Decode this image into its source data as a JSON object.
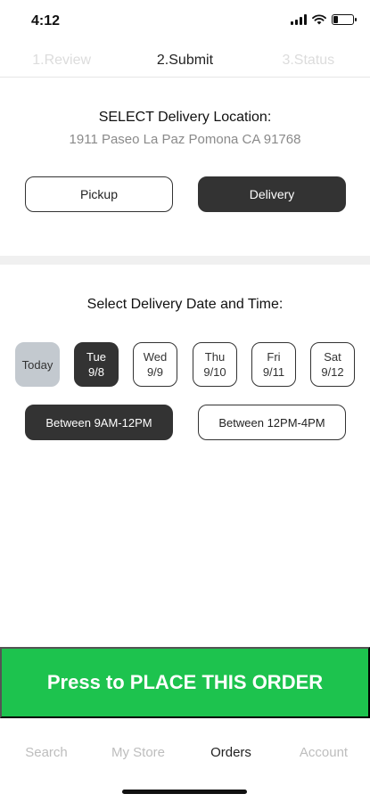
{
  "status_bar": {
    "time": "4:12"
  },
  "steps": [
    {
      "label": "1.Review"
    },
    {
      "label": "2.Submit"
    },
    {
      "label": "3.Status"
    }
  ],
  "location": {
    "title": "SELECT Delivery Location:",
    "address": "1911 Paseo La Paz Pomona CA 91768",
    "pickup_label": "Pickup",
    "delivery_label": "Delivery"
  },
  "datetime": {
    "title": "Select Delivery Date and Time:",
    "days": [
      {
        "name": "Today",
        "date": ""
      },
      {
        "name": "Tue",
        "date": "9/8"
      },
      {
        "name": "Wed",
        "date": "9/9"
      },
      {
        "name": "Thu",
        "date": "9/10"
      },
      {
        "name": "Fri",
        "date": "9/11"
      },
      {
        "name": "Sat",
        "date": "9/12"
      }
    ],
    "times": [
      {
        "label": "Between 9AM-12PM"
      },
      {
        "label": "Between 12PM-4PM"
      }
    ]
  },
  "place_order_label": "Press to PLACE THIS ORDER",
  "tabs": [
    {
      "label": "Search"
    },
    {
      "label": "My Store"
    },
    {
      "label": "Orders"
    },
    {
      "label": "Account"
    }
  ],
  "colors": {
    "accent_green": "#1dc34e",
    "selected_dark": "#333333",
    "today_gray": "#c3c9cf"
  }
}
